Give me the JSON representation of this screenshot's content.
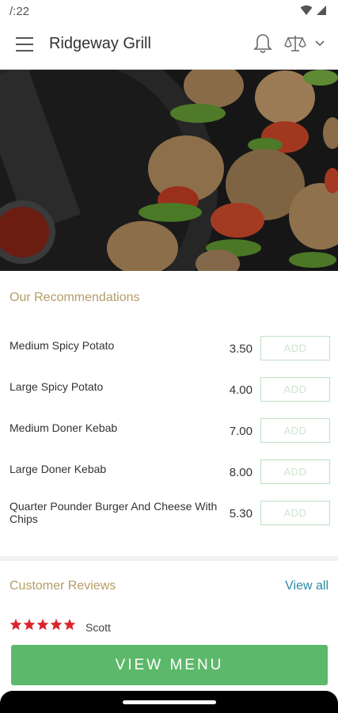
{
  "status_bar": {
    "time": "/:22"
  },
  "app_bar": {
    "title": "Ridgeway Grill"
  },
  "recommendations": {
    "title": "Our Recommendations",
    "items": [
      {
        "name": "Medium Spicy Potato",
        "price": "3.50",
        "button": "ADD"
      },
      {
        "name": "Large Spicy Potato",
        "price": "4.00",
        "button": "ADD"
      },
      {
        "name": "Medium Doner Kebab",
        "price": "7.00",
        "button": "ADD"
      },
      {
        "name": "Large Doner Kebab",
        "price": "8.00",
        "button": "ADD"
      },
      {
        "name": "Quarter Pounder Burger And Cheese With Chips",
        "price": "5.30",
        "button": "ADD"
      }
    ]
  },
  "reviews": {
    "title": "Customer Reviews",
    "view_all": "View all",
    "first_review": {
      "rating": 5,
      "reviewer": "Scott"
    }
  },
  "view_menu_button": "VIEW MENU",
  "colors": {
    "section_title": "#b59c66",
    "link": "#2b8aa6",
    "primary_button": "#5cb86a",
    "add_border": "#bfe0c4",
    "star": "#d9262c"
  },
  "icons": {
    "menu": "hamburger-icon",
    "notifications": "bell-icon",
    "account": "scale-icon",
    "expand": "chevron-down-icon"
  }
}
